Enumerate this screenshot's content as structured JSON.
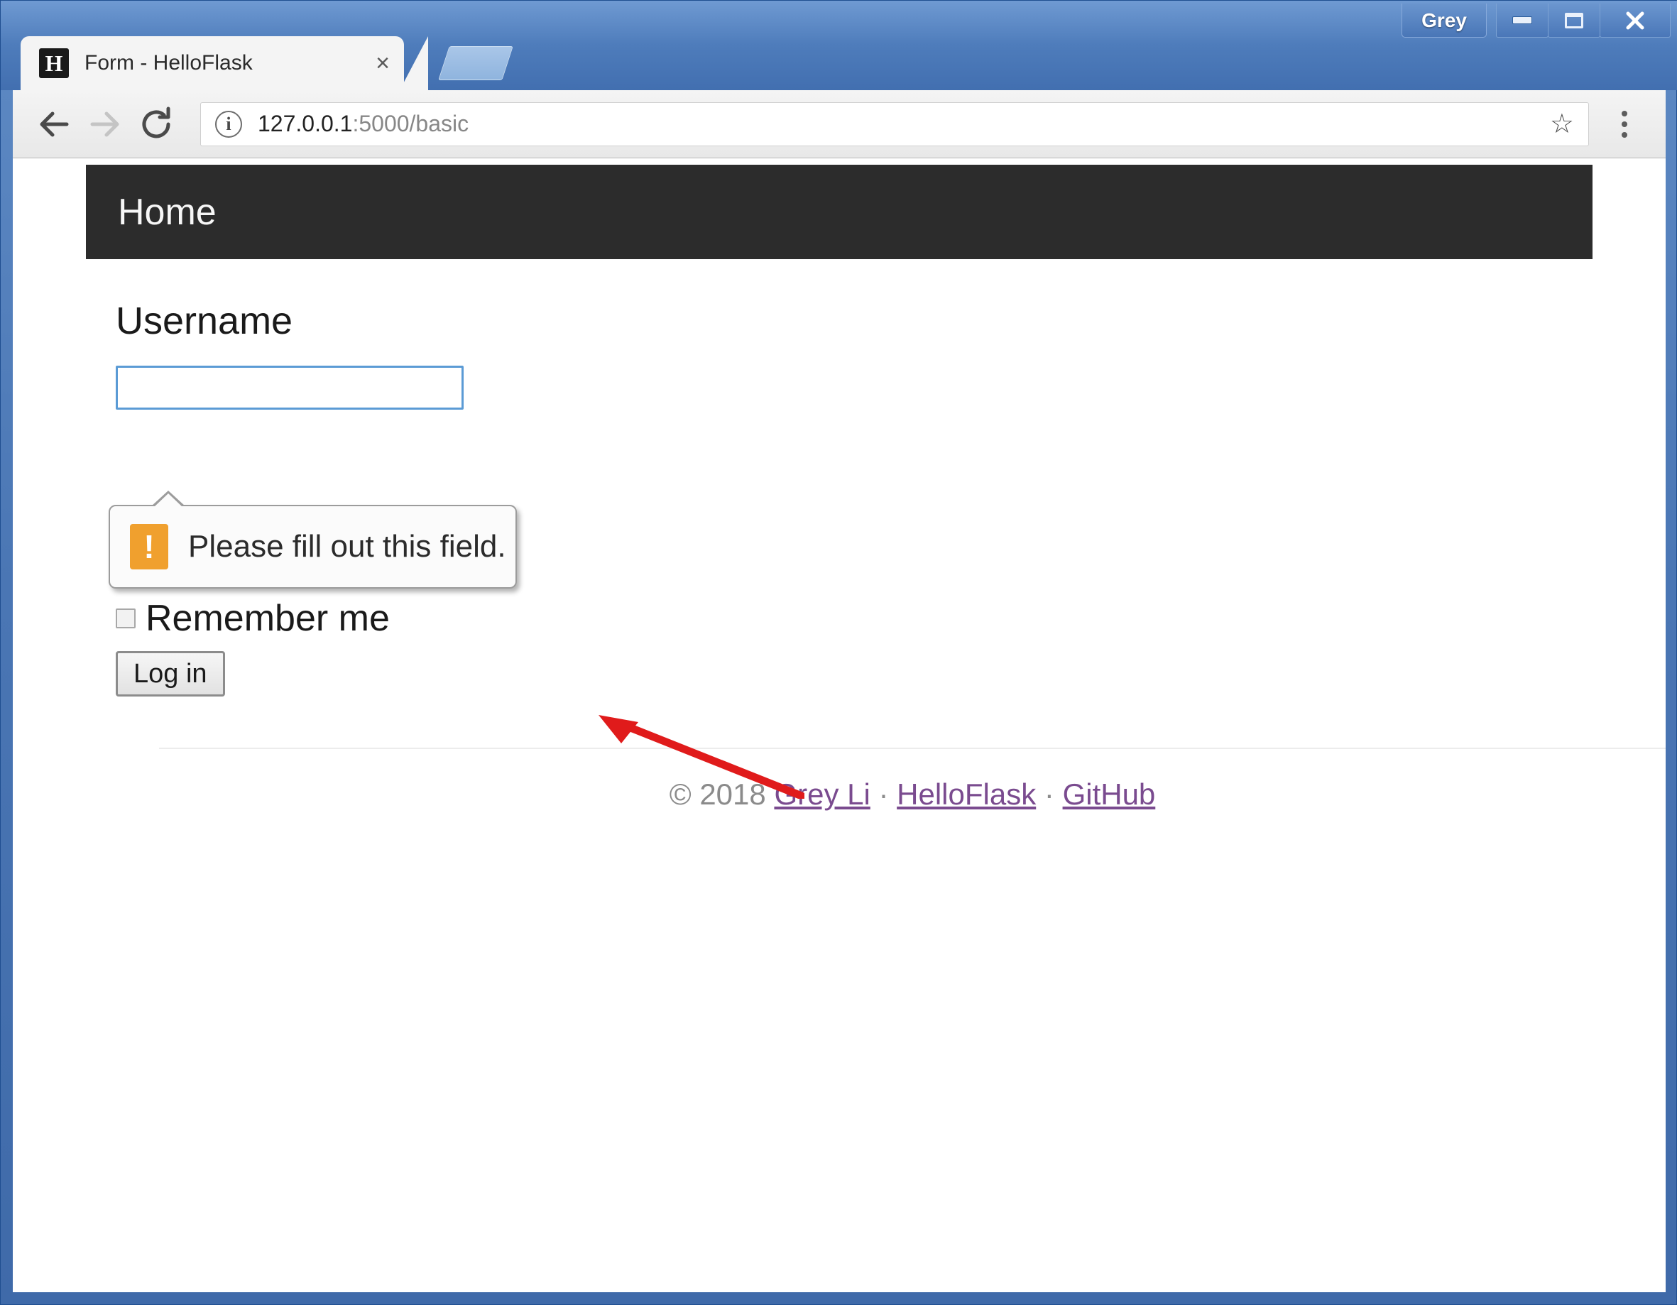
{
  "window": {
    "profile_button_label": "Grey",
    "minimize_label": "Minimize",
    "maximize_label": "Maximize",
    "close_label": "Close"
  },
  "browser": {
    "tab": {
      "title": "Form - HelloFlask",
      "favicon_letter": "H",
      "close_glyph": "×"
    },
    "new_tab_label": "New tab",
    "nav": {
      "back_glyph": "←",
      "forward_glyph": "→",
      "reload_glyph": "↻"
    },
    "omnibox": {
      "info_glyph": "i",
      "url_host": "127.0.0.1",
      "url_rest": ":5000/basic",
      "full_url": "127.0.0.1:5000/basic"
    },
    "star_glyph": "☆",
    "menu_label": "Customize and control"
  },
  "page": {
    "navbar": {
      "brand": "Home",
      "background_color": "#2c2c2c"
    },
    "form": {
      "username_label": "Username",
      "username_value": "",
      "username_placeholder": "",
      "focus_border_color": "#5b9bd5",
      "remember_label": "Remember me",
      "remember_checked": false,
      "submit_label": "Log in"
    },
    "validation": {
      "message": "Please fill out this field.",
      "icon_glyph": "!",
      "icon_color": "#f0a02e"
    },
    "footer": {
      "copyright": "© 2018",
      "links": [
        {
          "label": "Grey Li"
        },
        {
          "label": "HelloFlask"
        },
        {
          "label": "GitHub"
        }
      ],
      "separator": "·",
      "link_color": "#7a4b8f"
    }
  },
  "annotation": {
    "arrow_color": "#e01b1b",
    "arrow_description": "red arrow pointing at validation tooltip"
  }
}
